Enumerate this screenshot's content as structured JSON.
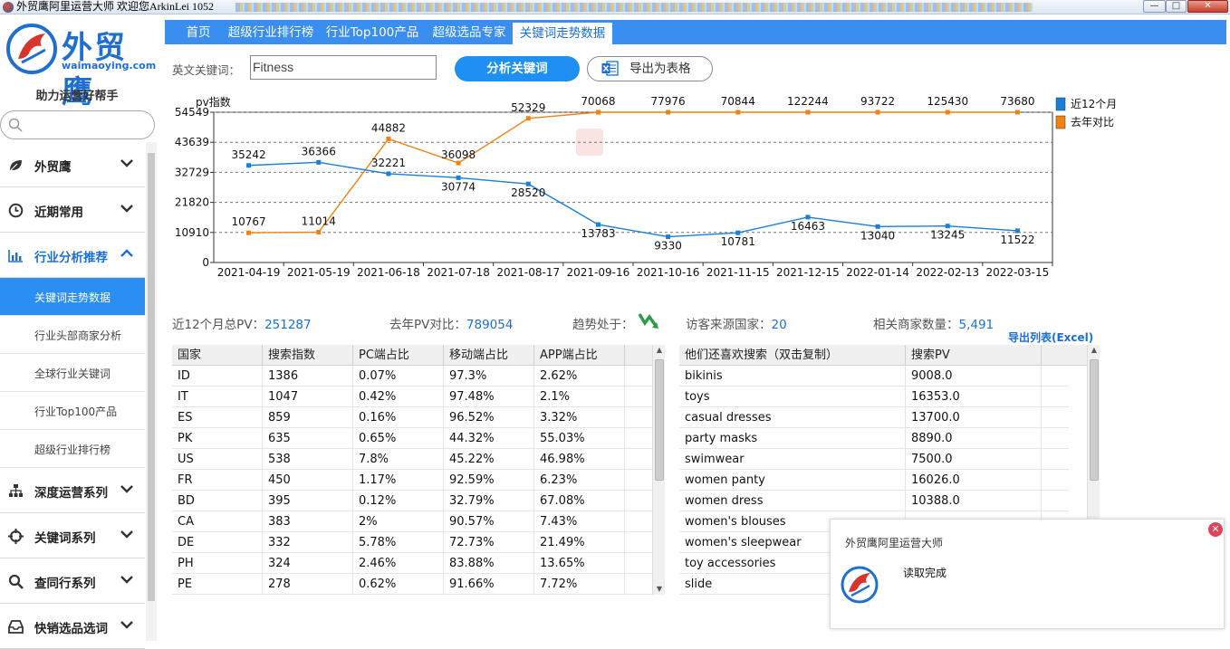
{
  "window": {
    "title": "外贸鹰阿里运营大师 欢迎您ArkinLei 1052",
    "min": "—",
    "max": "□",
    "close": "✕"
  },
  "sidebar": {
    "logo_cn": "外贸鹰",
    "logo_en": "waimaoying.com",
    "slogan": "助力运营好帮手",
    "search_placeholder": "",
    "menu": [
      {
        "label": "外贸鹰",
        "icon": "leaf-icon",
        "open": false
      },
      {
        "label": "近期常用",
        "icon": "clock-icon",
        "open": false
      },
      {
        "label": "行业分析推荐",
        "icon": "bar-chart-icon",
        "open": true
      }
    ],
    "submenu": [
      {
        "label": "关键词走势数据",
        "active": true
      },
      {
        "label": "行业头部商家分析",
        "active": false
      },
      {
        "label": "全球行业关键词",
        "active": false
      },
      {
        "label": "行业Top100产品",
        "active": false
      },
      {
        "label": "超级行业排行榜",
        "active": false
      }
    ],
    "menu2": [
      {
        "label": "深度运营系列",
        "icon": "hierarchy-icon"
      },
      {
        "label": "关键词系列",
        "icon": "crosshair-icon"
      },
      {
        "label": "查同行系列",
        "icon": "magnifier-icon"
      },
      {
        "label": "快销选品选词",
        "icon": "inbox-icon"
      }
    ]
  },
  "tabs": [
    {
      "label": "首页",
      "active": false
    },
    {
      "label": "超级行业排行榜",
      "active": false
    },
    {
      "label": "行业Top100产品",
      "active": false
    },
    {
      "label": "超级选品专家",
      "active": false
    },
    {
      "label": "关键词走势数据",
      "active": true
    }
  ],
  "toolbar": {
    "keyword_label": "英文关键词：",
    "keyword_value": "Fitness",
    "analyze_label": "分析关键词",
    "export_label": "导出为表格"
  },
  "chart_data": {
    "type": "line",
    "ylabel": "pv指数",
    "yticks": [
      0,
      10910,
      21820,
      32729,
      43639,
      54549
    ],
    "ylim": [
      0,
      54549
    ],
    "grid": true,
    "legend_position": "right",
    "categories": [
      "2021-04-19",
      "2021-05-19",
      "2021-06-18",
      "2021-07-18",
      "2021-08-17",
      "2021-09-16",
      "2021-10-16",
      "2021-11-15",
      "2021-12-15",
      "2022-01-14",
      "2022-02-13",
      "2022-03-15"
    ],
    "series": [
      {
        "name": "近12个月",
        "color": "#1a7fd6",
        "values": [
          35242,
          36366,
          32221,
          30774,
          28520,
          13783,
          9330,
          10781,
          16463,
          13040,
          13245,
          11522
        ],
        "labels": [
          "35242",
          "36366",
          "32221",
          "30774",
          "28520",
          "13783",
          "9330",
          "10781",
          "16463",
          "13040",
          "13245",
          "11522"
        ]
      },
      {
        "name": "去年对比",
        "color": "#f0820f",
        "values": [
          10767,
          11014,
          44882,
          36098,
          52329,
          54549,
          54549,
          54549,
          54549,
          54549,
          54549,
          54549
        ],
        "labels": [
          "10767",
          "11014",
          "44882",
          "36098",
          "52329",
          "70068",
          "77976",
          "70844",
          "122244",
          "93722",
          "125430",
          "73680"
        ]
      }
    ]
  },
  "stats": {
    "total_label": "近12个月总PV：",
    "total_value": "251287",
    "lastyear_label": "去年PV对比：",
    "lastyear_value": "789054",
    "trend_label": "趋势处于：",
    "countries_label": "访客来源国家：",
    "countries_value": "20",
    "merchants_label": "相关商家数量：",
    "merchants_value": "5,491",
    "export_list": "导出列表(Excel)"
  },
  "country_table": {
    "headers": [
      "国家",
      "搜索指数",
      "PC端占比",
      "移动端占比",
      "APP端占比"
    ],
    "rows": [
      [
        "ID",
        "1386",
        "0.07%",
        "97.3%",
        "2.62%"
      ],
      [
        "IT",
        "1047",
        "0.42%",
        "97.48%",
        "2.1%"
      ],
      [
        "ES",
        "859",
        "0.16%",
        "96.52%",
        "3.32%"
      ],
      [
        "PK",
        "635",
        "0.65%",
        "44.32%",
        "55.03%"
      ],
      [
        "US",
        "538",
        "7.8%",
        "45.22%",
        "46.98%"
      ],
      [
        "FR",
        "450",
        "1.17%",
        "92.59%",
        "6.23%"
      ],
      [
        "BD",
        "395",
        "0.12%",
        "32.79%",
        "67.08%"
      ],
      [
        "CA",
        "383",
        "2%",
        "90.57%",
        "7.43%"
      ],
      [
        "DE",
        "332",
        "5.78%",
        "72.73%",
        "21.49%"
      ],
      [
        "PH",
        "324",
        "2.46%",
        "83.88%",
        "13.65%"
      ],
      [
        "PE",
        "278",
        "0.62%",
        "91.66%",
        "7.72%"
      ]
    ]
  },
  "related_table": {
    "headers": [
      "他们还喜欢搜索（双击复制）",
      "搜索PV"
    ],
    "rows": [
      [
        "bikinis",
        "9008.0"
      ],
      [
        "toys",
        "16353.0"
      ],
      [
        "casual dresses",
        "13700.0"
      ],
      [
        "party masks",
        "8890.0"
      ],
      [
        "swimwear",
        "7500.0"
      ],
      [
        "women panty",
        "16026.0"
      ],
      [
        "women dress",
        "10388.0"
      ],
      [
        "women's blouses",
        ""
      ],
      [
        "women's  sleepwear",
        ""
      ],
      [
        "toy accessories",
        ""
      ],
      [
        "slide",
        ""
      ]
    ]
  },
  "popup": {
    "title": "外贸鹰阿里运营大师",
    "message": "读取完成",
    "close": "✕"
  }
}
